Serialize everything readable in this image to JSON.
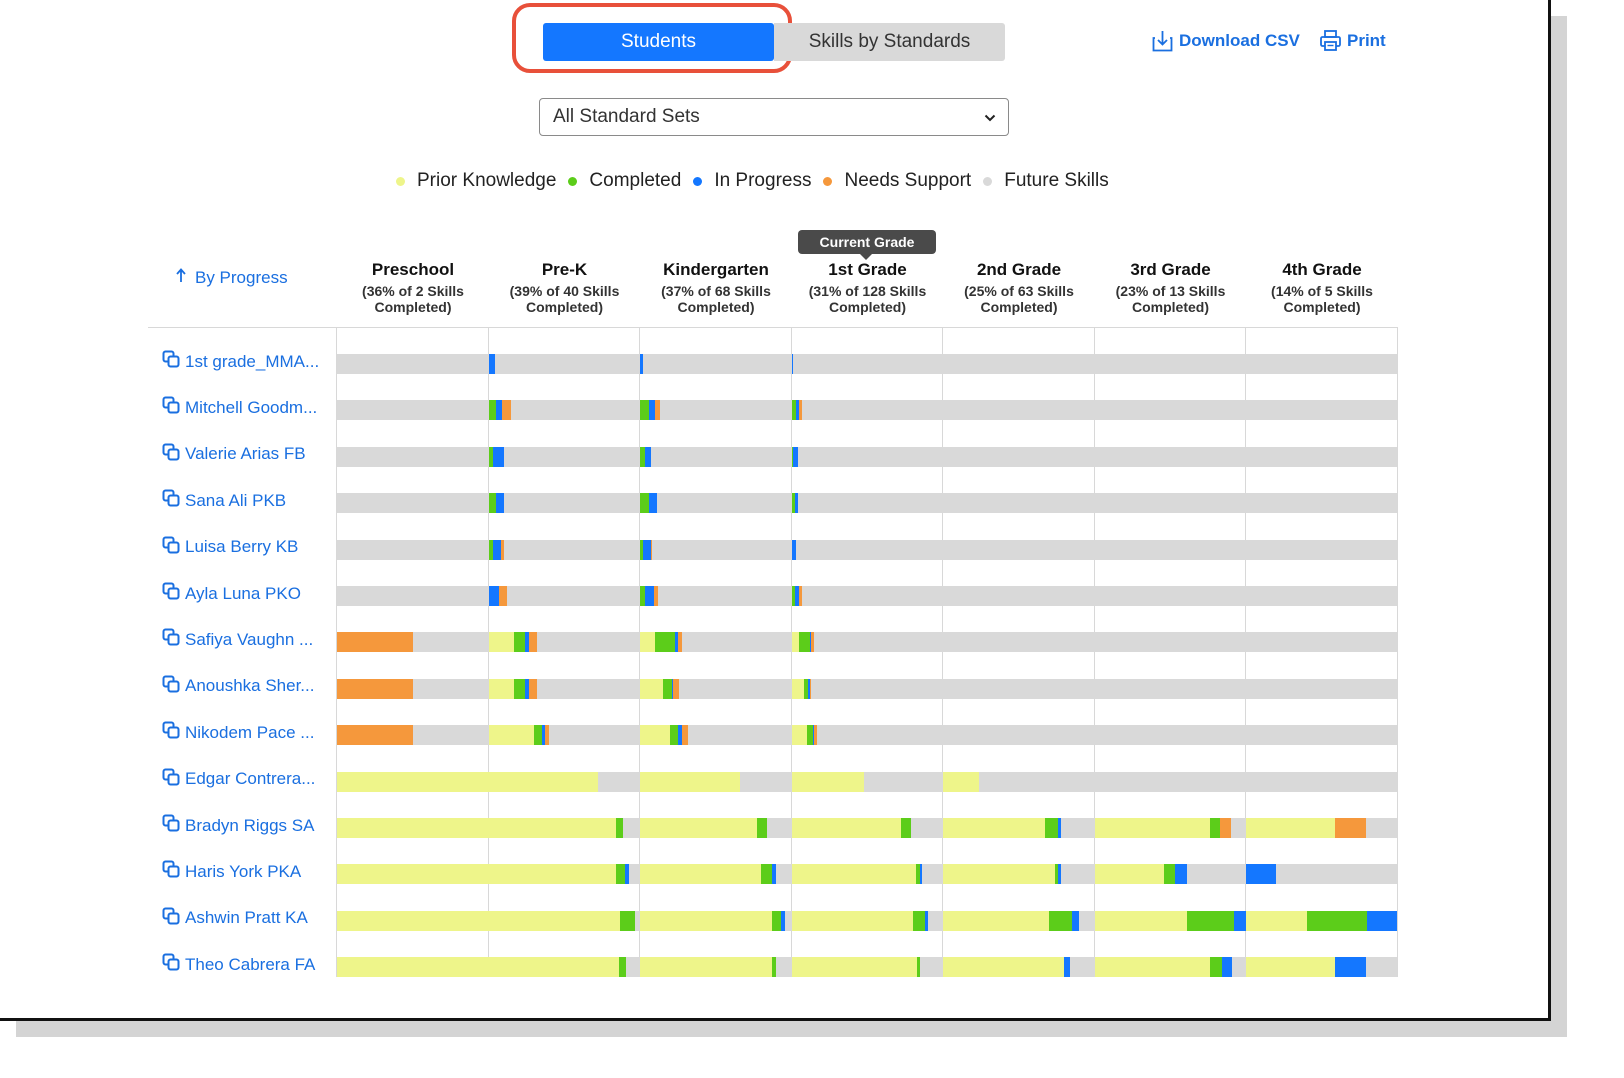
{
  "tabs": {
    "students": "Students",
    "skills_by_standards": "Skills by Standards"
  },
  "actions": {
    "download_csv": "Download CSV",
    "print": "Print"
  },
  "select": {
    "value": "All Standard Sets"
  },
  "colors": {
    "prior_knowledge": "#eef58a",
    "completed": "#5ccd1a",
    "in_progress": "#1477ff",
    "needs_support": "#f5983c",
    "future_skills": "#d9d9d9",
    "link": "#1a6fe0",
    "highlight": "#e8503a"
  },
  "legend": [
    {
      "key": "prior_knowledge",
      "label": "Prior Knowledge"
    },
    {
      "key": "completed",
      "label": "Completed"
    },
    {
      "key": "in_progress",
      "label": "In Progress"
    },
    {
      "key": "needs_support",
      "label": "Needs Support"
    },
    {
      "key": "future_skills",
      "label": "Future Skills"
    }
  ],
  "current_grade_badge": "Current Grade",
  "sort": {
    "label": "By Progress"
  },
  "grades": [
    {
      "name": "Preschool",
      "summary": "(36% of 2 Skills Completed)"
    },
    {
      "name": "Pre-K",
      "summary": "(39% of 40 Skills Completed)"
    },
    {
      "name": "Kindergarten",
      "summary": "(37% of 68 Skills Completed)"
    },
    {
      "name": "1st Grade",
      "summary": "(31% of 128 Skills Completed)"
    },
    {
      "name": "2nd Grade",
      "summary": "(25% of 63 Skills Completed)"
    },
    {
      "name": "3rd Grade",
      "summary": "(23% of 13 Skills Completed)"
    },
    {
      "name": "4th Grade",
      "summary": "(14% of 5 Skills Completed)"
    }
  ],
  "students": [
    {
      "name": "1st grade_MMA...",
      "progress": [
        [],
        [
          [
            0,
            0.04,
            "in_progress"
          ]
        ],
        [
          [
            0,
            0.02,
            "in_progress"
          ]
        ],
        [
          [
            0,
            0.01,
            "in_progress"
          ]
        ],
        [],
        [],
        []
      ]
    },
    {
      "name": "Mitchell Goodm...",
      "progress": [
        [],
        [
          [
            0,
            0.05,
            "completed"
          ],
          [
            0.05,
            0.09,
            "in_progress"
          ],
          [
            0.09,
            0.15,
            "needs_support"
          ]
        ],
        [
          [
            0,
            0.06,
            "completed"
          ],
          [
            0.06,
            0.1,
            "in_progress"
          ],
          [
            0.1,
            0.13,
            "needs_support"
          ]
        ],
        [
          [
            0,
            0.03,
            "completed"
          ],
          [
            0.03,
            0.05,
            "in_progress"
          ],
          [
            0.05,
            0.07,
            "needs_support"
          ]
        ],
        [],
        [],
        []
      ]
    },
    {
      "name": "Valerie Arias FB",
      "progress": [
        [],
        [
          [
            0,
            0.03,
            "completed"
          ],
          [
            0.03,
            0.1,
            "in_progress"
          ]
        ],
        [
          [
            0,
            0.03,
            "completed"
          ],
          [
            0.03,
            0.07,
            "in_progress"
          ]
        ],
        [
          [
            0,
            0.01,
            "completed"
          ],
          [
            0.01,
            0.04,
            "in_progress"
          ]
        ],
        [],
        [],
        []
      ]
    },
    {
      "name": "Sana Ali PKB",
      "progress": [
        [],
        [
          [
            0,
            0.05,
            "completed"
          ],
          [
            0.05,
            0.1,
            "in_progress"
          ]
        ],
        [
          [
            0,
            0.06,
            "completed"
          ],
          [
            0.06,
            0.11,
            "in_progress"
          ]
        ],
        [
          [
            0,
            0.02,
            "completed"
          ],
          [
            0.02,
            0.04,
            "in_progress"
          ]
        ],
        [],
        [],
        []
      ]
    },
    {
      "name": "Luisa Berry KB",
      "progress": [
        [],
        [
          [
            0,
            0.03,
            "completed"
          ],
          [
            0.03,
            0.08,
            "in_progress"
          ],
          [
            0.08,
            0.1,
            "needs_support"
          ]
        ],
        [
          [
            0,
            0.02,
            "completed"
          ],
          [
            0.02,
            0.07,
            "in_progress"
          ],
          [
            0.07,
            0.08,
            "needs_support"
          ]
        ],
        [
          [
            0,
            0.03,
            "in_progress"
          ]
        ],
        [],
        [],
        []
      ]
    },
    {
      "name": "Ayla Luna PKO",
      "progress": [
        [],
        [
          [
            0,
            0.07,
            "in_progress"
          ],
          [
            0.07,
            0.12,
            "needs_support"
          ]
        ],
        [
          [
            0,
            0.03,
            "completed"
          ],
          [
            0.03,
            0.09,
            "in_progress"
          ],
          [
            0.09,
            0.12,
            "needs_support"
          ]
        ],
        [
          [
            0,
            0.02,
            "completed"
          ],
          [
            0.02,
            0.05,
            "in_progress"
          ],
          [
            0.05,
            0.07,
            "needs_support"
          ]
        ],
        [],
        [],
        []
      ]
    },
    {
      "name": "Safiya Vaughn ...",
      "progress": [
        [
          [
            0,
            0.5,
            "needs_support"
          ]
        ],
        [
          [
            0,
            0.17,
            "prior_knowledge"
          ],
          [
            0.17,
            0.24,
            "completed"
          ],
          [
            0.24,
            0.27,
            "in_progress"
          ],
          [
            0.27,
            0.32,
            "needs_support"
          ]
        ],
        [
          [
            0,
            0.1,
            "prior_knowledge"
          ],
          [
            0.1,
            0.23,
            "completed"
          ],
          [
            0.23,
            0.25,
            "in_progress"
          ],
          [
            0.25,
            0.28,
            "needs_support"
          ]
        ],
        [
          [
            0,
            0.05,
            "prior_knowledge"
          ],
          [
            0.05,
            0.12,
            "completed"
          ],
          [
            0.12,
            0.13,
            "in_progress"
          ],
          [
            0.13,
            0.15,
            "needs_support"
          ]
        ],
        [],
        [],
        []
      ]
    },
    {
      "name": "Anoushka Sher...",
      "progress": [
        [
          [
            0,
            0.5,
            "needs_support"
          ]
        ],
        [
          [
            0,
            0.17,
            "prior_knowledge"
          ],
          [
            0.17,
            0.24,
            "completed"
          ],
          [
            0.24,
            0.27,
            "in_progress"
          ],
          [
            0.27,
            0.32,
            "needs_support"
          ]
        ],
        [
          [
            0,
            0.15,
            "prior_knowledge"
          ],
          [
            0.15,
            0.21,
            "completed"
          ],
          [
            0.21,
            0.22,
            "in_progress"
          ],
          [
            0.22,
            0.26,
            "needs_support"
          ]
        ],
        [
          [
            0,
            0.08,
            "prior_knowledge"
          ],
          [
            0.08,
            0.11,
            "completed"
          ],
          [
            0.11,
            0.12,
            "in_progress"
          ],
          [
            0.12,
            0.13,
            "needs_support"
          ]
        ],
        [],
        [],
        []
      ]
    },
    {
      "name": "Nikodem Pace ...",
      "progress": [
        [
          [
            0,
            0.5,
            "needs_support"
          ]
        ],
        [
          [
            0,
            0.3,
            "prior_knowledge"
          ],
          [
            0.3,
            0.35,
            "completed"
          ],
          [
            0.35,
            0.37,
            "in_progress"
          ],
          [
            0.37,
            0.4,
            "needs_support"
          ]
        ],
        [
          [
            0,
            0.2,
            "prior_knowledge"
          ],
          [
            0.2,
            0.25,
            "completed"
          ],
          [
            0.25,
            0.28,
            "in_progress"
          ],
          [
            0.28,
            0.32,
            "needs_support"
          ]
        ],
        [
          [
            0,
            0.1,
            "prior_knowledge"
          ],
          [
            0.1,
            0.14,
            "completed"
          ],
          [
            0.14,
            0.15,
            "in_progress"
          ],
          [
            0.15,
            0.17,
            "needs_support"
          ]
        ],
        [],
        [],
        []
      ]
    },
    {
      "name": "Edgar Contrera...",
      "progress": [
        [
          [
            0,
            1,
            "prior_knowledge"
          ]
        ],
        [
          [
            0,
            0.72,
            "prior_knowledge"
          ]
        ],
        [
          [
            0,
            0.66,
            "prior_knowledge"
          ]
        ],
        [
          [
            0,
            0.48,
            "prior_knowledge"
          ]
        ],
        [
          [
            0,
            0.24,
            "prior_knowledge"
          ]
        ],
        [],
        []
      ]
    },
    {
      "name": "Bradyn Riggs SA",
      "progress": [
        [
          [
            0,
            1,
            "prior_knowledge"
          ]
        ],
        [
          [
            0,
            0.84,
            "prior_knowledge"
          ],
          [
            0.84,
            0.89,
            "completed"
          ]
        ],
        [
          [
            0,
            0.77,
            "prior_knowledge"
          ],
          [
            0.77,
            0.84,
            "completed"
          ]
        ],
        [
          [
            0,
            0.72,
            "prior_knowledge"
          ],
          [
            0.72,
            0.79,
            "completed"
          ]
        ],
        [
          [
            0,
            0.67,
            "prior_knowledge"
          ],
          [
            0.67,
            0.76,
            "completed"
          ],
          [
            0.76,
            0.78,
            "in_progress"
          ]
        ],
        [
          [
            0,
            0.76,
            "prior_knowledge"
          ],
          [
            0.76,
            0.83,
            "completed"
          ],
          [
            0.83,
            0.9,
            "needs_support"
          ]
        ],
        [
          [
            0,
            0.59,
            "prior_knowledge"
          ],
          [
            0.59,
            0.79,
            "needs_support"
          ]
        ]
      ]
    },
    {
      "name": "Haris York PKA",
      "progress": [
        [
          [
            0,
            1,
            "prior_knowledge"
          ]
        ],
        [
          [
            0,
            0.84,
            "prior_knowledge"
          ],
          [
            0.84,
            0.9,
            "completed"
          ],
          [
            0.9,
            0.93,
            "in_progress"
          ]
        ],
        [
          [
            0,
            0.8,
            "prior_knowledge"
          ],
          [
            0.8,
            0.87,
            "completed"
          ],
          [
            0.87,
            0.9,
            "in_progress"
          ]
        ],
        [
          [
            0,
            0.82,
            "prior_knowledge"
          ],
          [
            0.82,
            0.85,
            "completed"
          ],
          [
            0.85,
            0.86,
            "in_progress"
          ]
        ],
        [
          [
            0,
            0.74,
            "prior_knowledge"
          ],
          [
            0.74,
            0.76,
            "completed"
          ],
          [
            0.76,
            0.78,
            "in_progress"
          ]
        ],
        [
          [
            0,
            0.46,
            "prior_knowledge"
          ],
          [
            0.46,
            0.53,
            "completed"
          ],
          [
            0.53,
            0.61,
            "in_progress"
          ]
        ],
        [
          [
            0,
            0.2,
            "in_progress"
          ]
        ]
      ]
    },
    {
      "name": "Ashwin Pratt KA",
      "progress": [
        [
          [
            0,
            1,
            "prior_knowledge"
          ]
        ],
        [
          [
            0,
            0.87,
            "prior_knowledge"
          ],
          [
            0.87,
            0.97,
            "completed"
          ]
        ],
        [
          [
            0,
            0.87,
            "prior_knowledge"
          ],
          [
            0.87,
            0.93,
            "completed"
          ],
          [
            0.93,
            0.96,
            "in_progress"
          ]
        ],
        [
          [
            0,
            0.8,
            "prior_knowledge"
          ],
          [
            0.8,
            0.88,
            "completed"
          ],
          [
            0.88,
            0.9,
            "in_progress"
          ]
        ],
        [
          [
            0,
            0.7,
            "prior_knowledge"
          ],
          [
            0.7,
            0.85,
            "completed"
          ],
          [
            0.85,
            0.9,
            "in_progress"
          ]
        ],
        [
          [
            0,
            0.61,
            "prior_knowledge"
          ],
          [
            0.61,
            0.92,
            "completed"
          ],
          [
            0.92,
            1,
            "in_progress"
          ]
        ],
        [
          [
            0,
            0.4,
            "prior_knowledge"
          ],
          [
            0.4,
            0.8,
            "completed"
          ],
          [
            0.8,
            1,
            "in_progress"
          ]
        ]
      ]
    },
    {
      "name": "Theo Cabrera FA",
      "progress": [
        [
          [
            0,
            1,
            "prior_knowledge"
          ]
        ],
        [
          [
            0,
            0.86,
            "prior_knowledge"
          ],
          [
            0.86,
            0.91,
            "completed"
          ]
        ],
        [
          [
            0,
            0.87,
            "prior_knowledge"
          ],
          [
            0.87,
            0.9,
            "completed"
          ]
        ],
        [
          [
            0,
            0.83,
            "prior_knowledge"
          ],
          [
            0.83,
            0.85,
            "completed"
          ]
        ],
        [
          [
            0,
            0.8,
            "prior_knowledge"
          ],
          [
            0.8,
            0.84,
            "in_progress"
          ]
        ],
        [
          [
            0,
            0.76,
            "prior_knowledge"
          ],
          [
            0.76,
            0.84,
            "completed"
          ],
          [
            0.84,
            0.91,
            "in_progress"
          ]
        ],
        [
          [
            0,
            0.59,
            "prior_knowledge"
          ],
          [
            0.59,
            0.79,
            "in_progress"
          ]
        ]
      ]
    }
  ]
}
